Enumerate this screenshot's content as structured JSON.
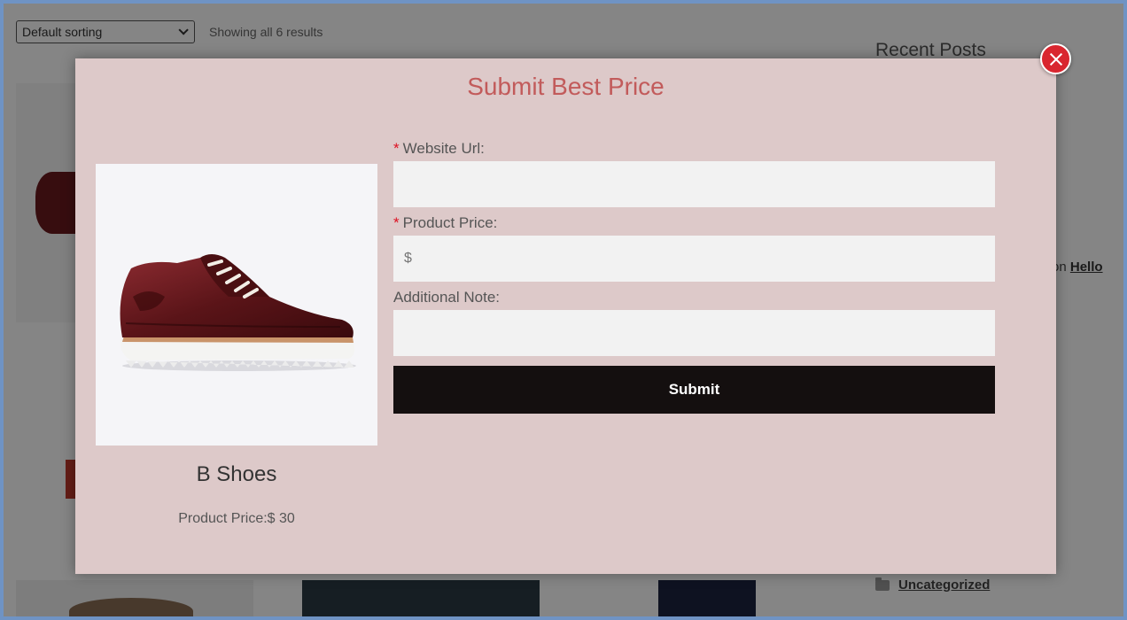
{
  "shop": {
    "sorting": "Default sorting",
    "result_count": "Showing all 6 results"
  },
  "sidebar": {
    "recent_posts_title": "Recent Posts",
    "comment_prefix": "on",
    "comment_link": "Hello",
    "category": "Uncategorized"
  },
  "modal": {
    "title": "Submit Best Price",
    "product_name": "B Shoes",
    "product_price_label": "Product Price:$ 30",
    "required_marker": "*",
    "fields": {
      "website_url_label": "Website Url:",
      "product_price_label": "Product Price:",
      "product_price_placeholder": "$",
      "additional_note_label": "Additional Note:"
    },
    "submit_label": "Submit"
  },
  "colors": {
    "modal_bg": "#ddc9c9",
    "title": "#c25b5b",
    "close_button": "#d9262f",
    "submit_bg": "#140f0f",
    "required": "#dd1122"
  },
  "icons": [
    "close-icon",
    "folder-icon",
    "chevron-down-icon"
  ]
}
